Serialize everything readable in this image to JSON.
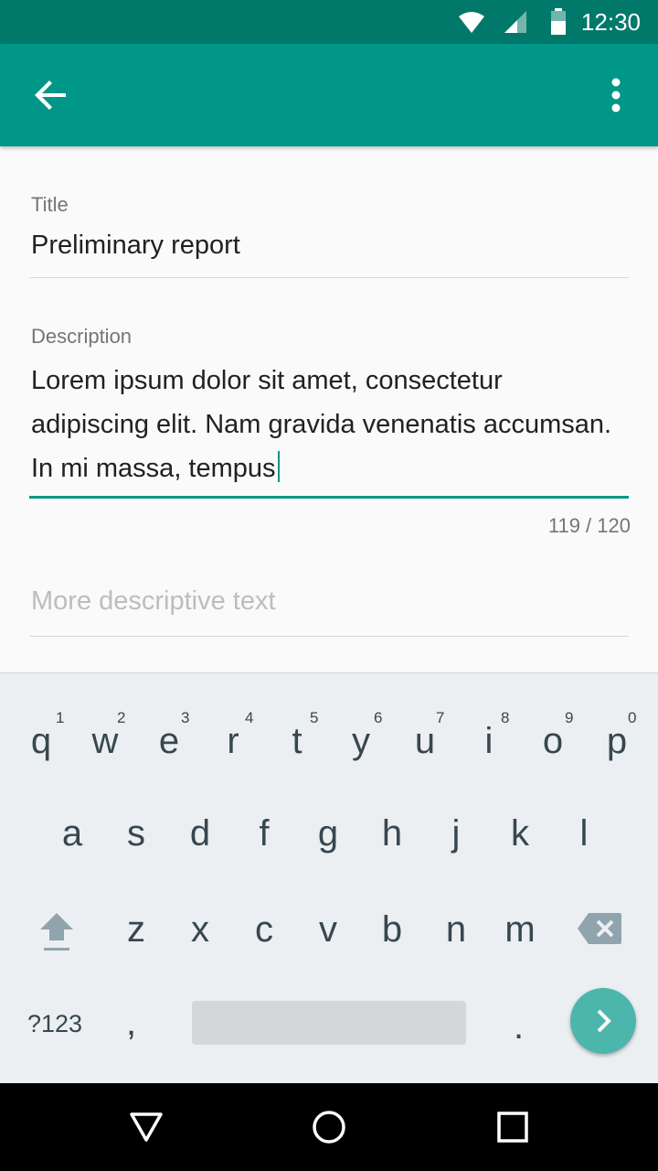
{
  "status_bar": {
    "time": "12:30",
    "icons": [
      "wifi-icon",
      "signal-icon",
      "battery-icon"
    ]
  },
  "app_bar": {
    "back_icon": "arrow-back-icon",
    "menu_icon": "more-vert-icon"
  },
  "form": {
    "title_label": "Title",
    "title_value": "Preliminary report",
    "description_label": "Description",
    "description_value": "Lorem ipsum dolor sit amet, consectetur adipiscing elit. Nam gravida venenatis accumsan. In mi massa, tempus",
    "counter": "119 / 120",
    "more_placeholder": "More descriptive text"
  },
  "keyboard": {
    "row1": [
      "q",
      "w",
      "e",
      "r",
      "t",
      "y",
      "u",
      "i",
      "o",
      "p"
    ],
    "row1_hints": [
      "1",
      "2",
      "3",
      "4",
      "5",
      "6",
      "7",
      "8",
      "9",
      "0"
    ],
    "row2": [
      "a",
      "s",
      "d",
      "f",
      "g",
      "h",
      "j",
      "k",
      "l"
    ],
    "row3": [
      "z",
      "x",
      "c",
      "v",
      "b",
      "n",
      "m"
    ],
    "symbols_label": "?123",
    "comma": ",",
    "period": "."
  },
  "colors": {
    "primary": "#009688",
    "primary_dark": "#00796b",
    "accent": "#4db6ac"
  }
}
